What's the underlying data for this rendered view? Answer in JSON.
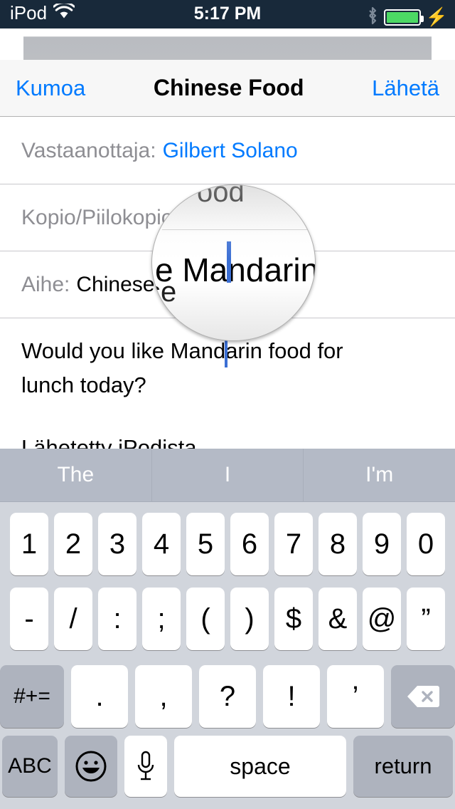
{
  "status_bar": {
    "carrier": "iPod",
    "wifi_icon": "wifi-icon",
    "time": "5:17 PM",
    "bluetooth_icon": "bluetooth-icon",
    "battery_icon": "battery-full-icon",
    "charging_icon": "lightning-bolt-icon",
    "background_color": "#18293a",
    "battery_color": "#4cd964"
  },
  "nav_bar": {
    "cancel_label": "Kumoa",
    "title": "Chinese Food",
    "send_label": "Lähetä",
    "accent_color": "#007aff"
  },
  "compose": {
    "to": {
      "label": "Vastaanottaja:",
      "value": "Gilbert Solano"
    },
    "cc_bcc": {
      "label": "Kopio/Piilokopio:",
      "value": ""
    },
    "subject": {
      "label": "Aihe:",
      "value": "Chinese Food"
    },
    "body_line1": "Would you like Mandarin food for",
    "body_line2": "lunch today?",
    "signature": "Lähetetty iPodista",
    "label_color": "#8e8e93",
    "caret_color": "#3b6fd4"
  },
  "loupe": {
    "top_text": "ood",
    "magnified_text_before": "e Man",
    "magnified_text_after": "darin fo",
    "ghost_text": "se",
    "caret_color": "#3b6fd4"
  },
  "keyboard": {
    "predictions": [
      "The",
      "I",
      "I'm"
    ],
    "row_numbers": [
      "1",
      "2",
      "3",
      "4",
      "5",
      "6",
      "7",
      "8",
      "9",
      "0"
    ],
    "row_symbols": [
      "-",
      "/",
      ":",
      ";",
      "(",
      ")",
      "$",
      "&",
      "@",
      "”"
    ],
    "row_punctuation": [
      ".",
      ",",
      "?",
      "!",
      "’"
    ],
    "symbol_shift_label": "#+=",
    "backspace_icon": "backspace-icon",
    "abc_label": "ABC",
    "emoji_icon": "emoji-smiley-icon",
    "mic_icon": "microphone-icon",
    "space_label": "space",
    "return_label": "return",
    "background_color": "#d1d5dc",
    "predictive_background": "#b4bac6"
  }
}
